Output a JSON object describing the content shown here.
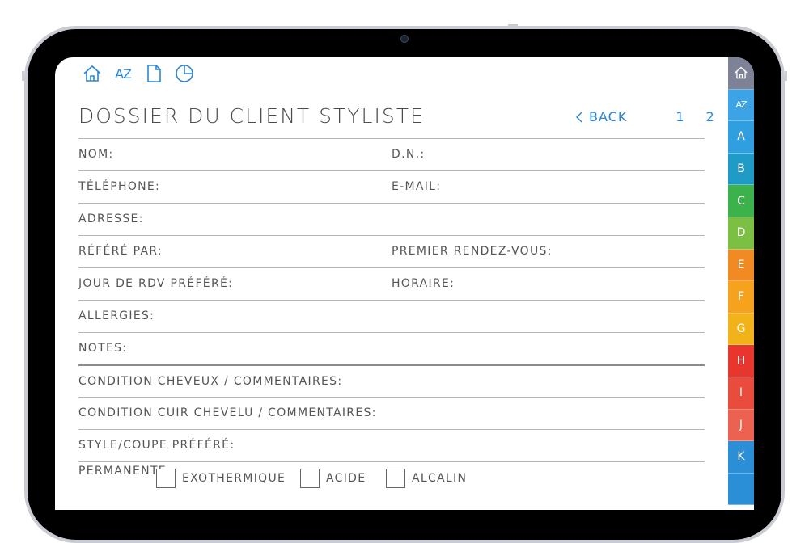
{
  "header": {
    "title": "DOSSIER DU CLIENT STYLISTE",
    "back_label": "BACK",
    "pages": [
      "1",
      "2"
    ]
  },
  "toolbar": {
    "icons": [
      "home-icon",
      "az-icon",
      "document-icon",
      "pie-chart-icon"
    ],
    "az_text": "AZ"
  },
  "form": {
    "nom": "NOM:",
    "dn": "D.N.:",
    "telephone": "TÉLÉPHONE:",
    "email": "E-MAIL:",
    "adresse": "ADRESSE:",
    "refere_par": "RÉFÉRÉ PAR:",
    "premier_rdv": "PREMIER RENDEZ-VOUS:",
    "jour_rdv": "JOUR DE RDV PRÉFÉRÉ:",
    "horaire": "HORAIRE:",
    "allergies": "ALLERGIES:",
    "notes": "NOTES:",
    "condition_cheveux": "CONDITION CHEVEUX / COMMENTAIRES:",
    "condition_cuir": "CONDITION CUIR CHEVELU / COMMENTAIRES:",
    "style_coupe": "STYLE/COUPE PRÉFÉRÉ:",
    "permanente": "PERMANENTE",
    "perm_options": [
      "EXOTHERMIQUE",
      "ACIDE",
      "ALCALIN"
    ]
  },
  "tabs": [
    {
      "label": "",
      "color": "#7d8296"
    },
    {
      "label": "AZ",
      "color": "#3ba3e6"
    },
    {
      "label": "A",
      "color": "#2f9fe0"
    },
    {
      "label": "B",
      "color": "#1f9bc8"
    },
    {
      "label": "C",
      "color": "#3cb24a"
    },
    {
      "label": "D",
      "color": "#7bc043"
    },
    {
      "label": "E",
      "color": "#f28a24"
    },
    {
      "label": "F",
      "color": "#f7a21d"
    },
    {
      "label": "G",
      "color": "#f2b21a"
    },
    {
      "label": "H",
      "color": "#e8362f"
    },
    {
      "label": "I",
      "color": "#e94c3c"
    },
    {
      "label": "J",
      "color": "#ec6150"
    },
    {
      "label": "K",
      "color": "#2b8fd8"
    },
    {
      "label": "",
      "color": "#2b8fd8"
    }
  ],
  "colors": {
    "accent": "#2a86d8",
    "text": "#555555",
    "rule": "#b4b4b4"
  }
}
